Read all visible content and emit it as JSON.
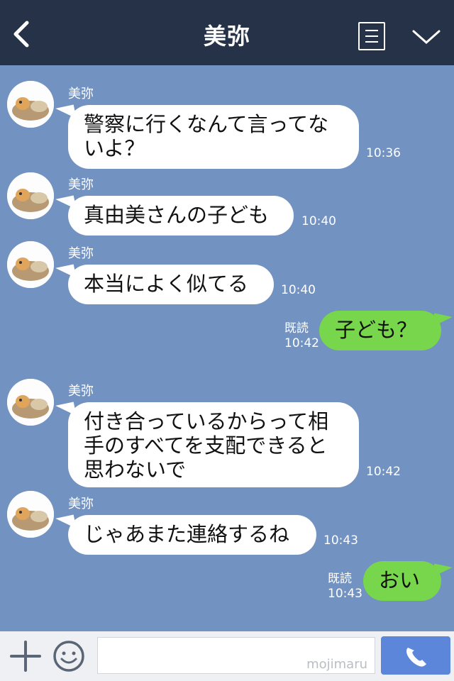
{
  "header": {
    "title": "美弥"
  },
  "messages": [
    {
      "sender": "美弥",
      "lines": [
        "警察に行くなんて言ってな",
        "いよ？"
      ],
      "time": "10:36"
    },
    {
      "sender": "美弥",
      "lines": [
        "真由美さんの子ども"
      ],
      "time": "10:40"
    },
    {
      "sender": "美弥",
      "lines": [
        "本当によく似てる"
      ],
      "time": "10:40"
    },
    {
      "read": "既読",
      "lines": [
        "子ども？"
      ],
      "time": "10:42"
    },
    {
      "sender": "美弥",
      "lines": [
        "付き合っているからって相",
        "手のすべてを支配できると",
        "思わないで"
      ],
      "time": "10:42"
    },
    {
      "sender": "美弥",
      "lines": [
        "じゃあまた連絡するね"
      ],
      "time": "10:43"
    },
    {
      "read": "既読",
      "lines": [
        "おい"
      ],
      "time": "10:43"
    }
  ],
  "footer": {
    "watermark": "mojimaru"
  },
  "colors": {
    "header": "#263248",
    "background": "#7292c1",
    "bubble_in": "#ffffff",
    "bubble_out": "#77d64b",
    "send": "#5b86d9"
  },
  "icons": [
    "back-arrow-icon",
    "menu-icon",
    "chevron-down-icon",
    "plus-icon",
    "smile-icon",
    "phone-icon"
  ]
}
